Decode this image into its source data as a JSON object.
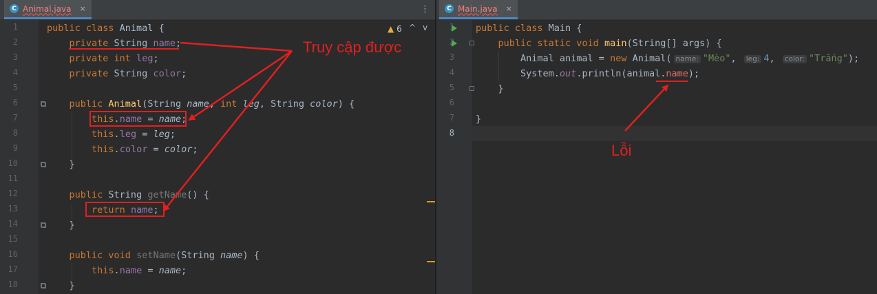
{
  "left": {
    "tab": {
      "icon": "C",
      "name": "Animal.java",
      "close": "×"
    },
    "menu": "⋮",
    "warnings": {
      "icon": "▲",
      "count": "6"
    },
    "nav_up": "^",
    "nav_down": "v",
    "line_numbers": [
      "1",
      "2",
      "3",
      "4",
      "5",
      "6",
      "7",
      "8",
      "9",
      "10",
      "11",
      "12",
      "13",
      "14",
      "15",
      "16",
      "17",
      "18"
    ]
  },
  "right": {
    "tab": {
      "icon": "C",
      "name": "Main.java",
      "close": "×"
    },
    "line_numbers": [
      "1",
      "2",
      "3",
      "4",
      "5",
      "6",
      "7",
      "8"
    ],
    "hints": {
      "name": "name:",
      "leg": "leg:",
      "color": "color:"
    }
  },
  "annotations": {
    "accessible": "Truy cập được",
    "error": "Lỗi"
  },
  "colors": {
    "annotation": "#e02020",
    "keyword": "#cc7832",
    "field": "#9876aa",
    "string": "#6a8759",
    "method": "#ffc66d"
  }
}
